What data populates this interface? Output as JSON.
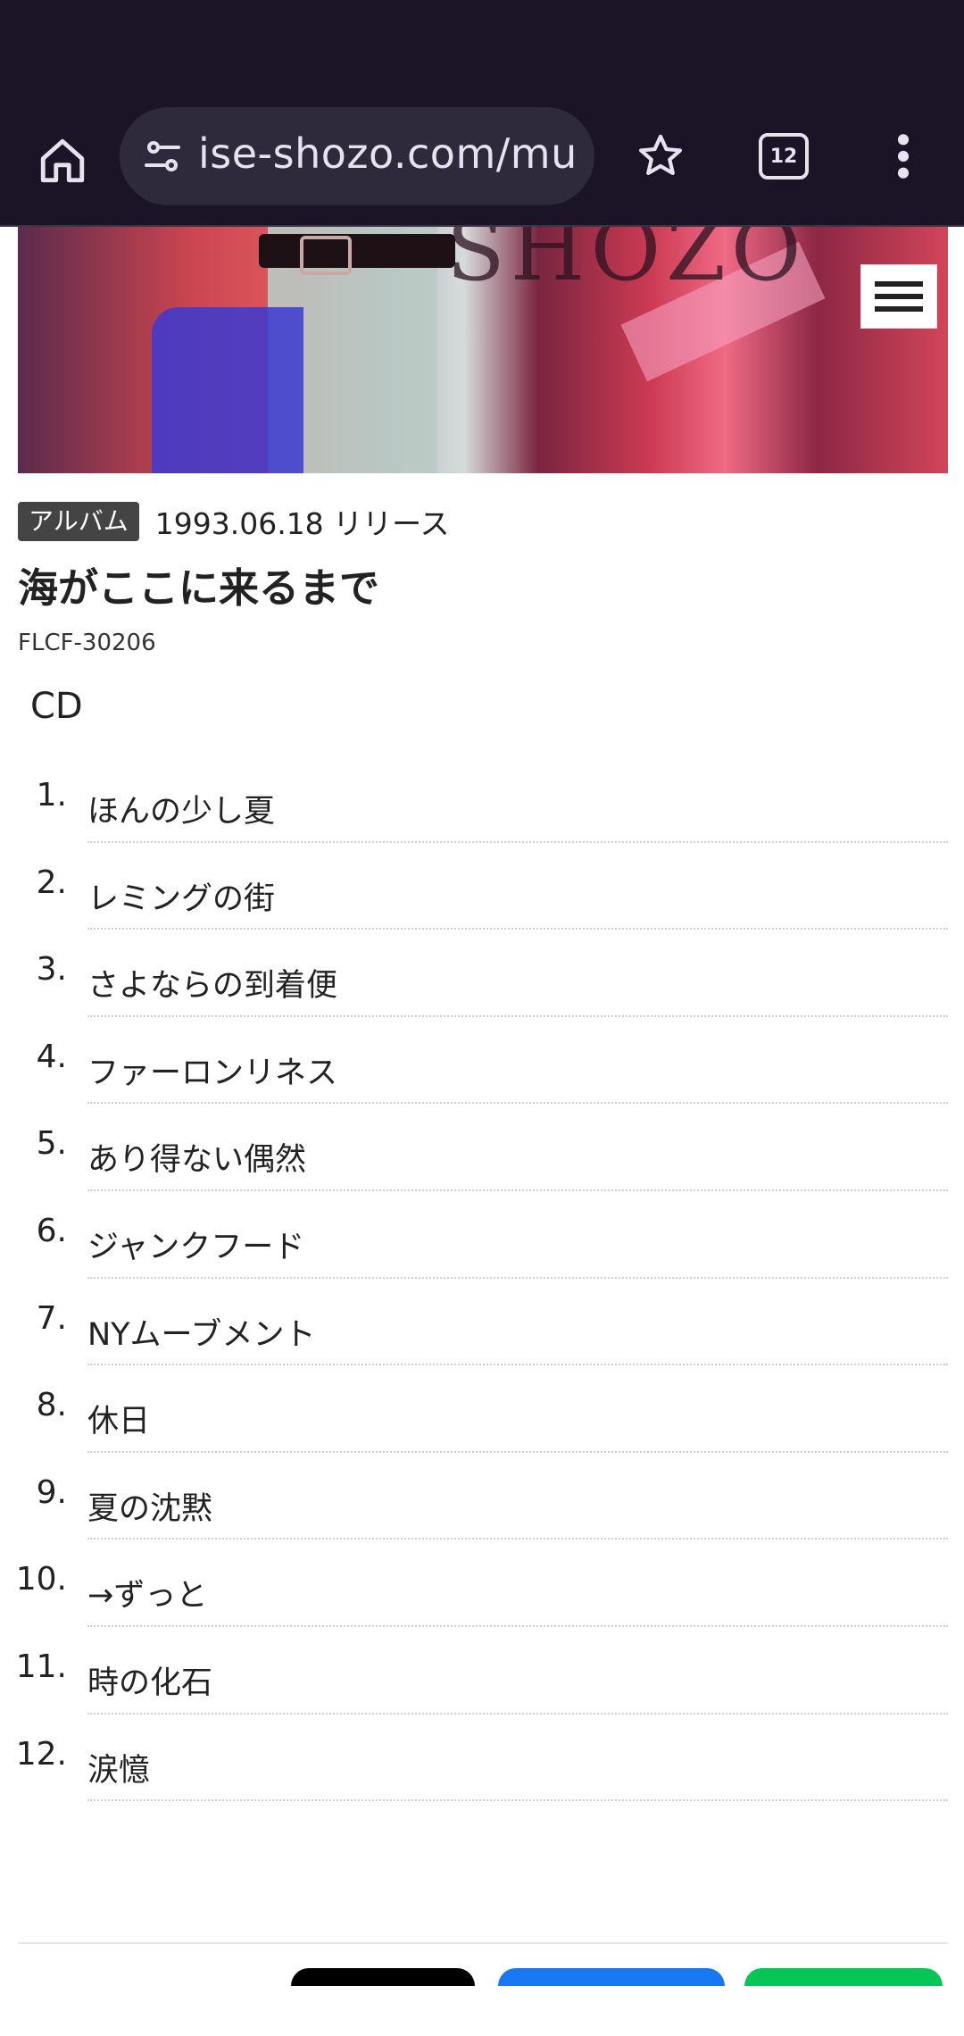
{
  "browser": {
    "url": "ise-shozo.com/mu",
    "tab_count": "12"
  },
  "hero": {
    "logo_text": "SHOZO"
  },
  "album": {
    "type_badge": "アルバム",
    "release": "1993.06.18 リリース",
    "title": "海がここに来るまで",
    "catalog": "FLCF-30206",
    "format": "CD"
  },
  "tracks": [
    {
      "num": "1.",
      "title": "ほんの少し夏"
    },
    {
      "num": "2.",
      "title": "レミングの街"
    },
    {
      "num": "3.",
      "title": "さよならの到着便"
    },
    {
      "num": "4.",
      "title": "ファーロンリネス"
    },
    {
      "num": "5.",
      "title": "あり得ない偶然"
    },
    {
      "num": "6.",
      "title": "ジャンクフード"
    },
    {
      "num": "7.",
      "title": "NYムーブメント"
    },
    {
      "num": "8.",
      "title": "休日"
    },
    {
      "num": "9.",
      "title": "夏の沈黙"
    },
    {
      "num": "10.",
      "title": "→ずっと"
    },
    {
      "num": "11.",
      "title": "時の化石"
    },
    {
      "num": "12.",
      "title": "涙憶"
    }
  ],
  "colors": {
    "chrome_bg": "#1a1426",
    "urlbar_bg": "#2e2a3b",
    "badge_bg": "#444444",
    "share_x": "#000000",
    "share_facebook": "#1877f2",
    "share_line": "#06c755"
  }
}
